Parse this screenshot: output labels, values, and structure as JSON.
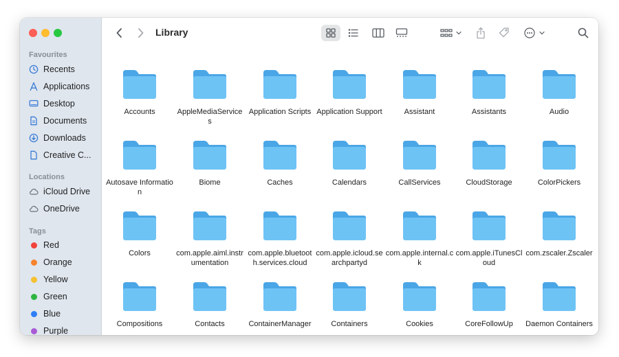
{
  "window": {
    "title": "Library"
  },
  "sidebar": {
    "favourites_heading": "Favourites",
    "favourites": [
      {
        "label": "Recents",
        "icon": "clock-icon"
      },
      {
        "label": "Applications",
        "icon": "applications-icon"
      },
      {
        "label": "Desktop",
        "icon": "desktop-icon"
      },
      {
        "label": "Documents",
        "icon": "document-icon"
      },
      {
        "label": "Downloads",
        "icon": "download-icon"
      },
      {
        "label": "Creative C...",
        "icon": "file-icon"
      }
    ],
    "locations_heading": "Locations",
    "locations": [
      {
        "label": "iCloud Drive",
        "icon": "cloud-icon"
      },
      {
        "label": "OneDrive",
        "icon": "cloud-icon"
      }
    ],
    "tags_heading": "Tags",
    "tags": [
      {
        "label": "Red",
        "color": "#f0443a"
      },
      {
        "label": "Orange",
        "color": "#f7842d"
      },
      {
        "label": "Yellow",
        "color": "#f5c132"
      },
      {
        "label": "Green",
        "color": "#2eb640"
      },
      {
        "label": "Blue",
        "color": "#2f7ef5"
      },
      {
        "label": "Purple",
        "color": "#a95bd6"
      }
    ]
  },
  "toolbar": {
    "back_icon": "chevron-left-icon",
    "forward_icon": "chevron-right-icon",
    "views": [
      "icon-view-icon",
      "list-view-icon",
      "column-view-icon",
      "gallery-view-icon"
    ],
    "group_icon": "group-icon",
    "share_icon": "share-icon",
    "tag_icon": "tag-icon",
    "more_icon": "more-icon",
    "search_icon": "search-icon"
  },
  "colors": {
    "folder_body": "#6ec3f5",
    "folder_tab": "#4aa6e6"
  },
  "folders": [
    [
      "Accounts",
      "AppleMediaServices",
      "Application Scripts",
      "Application Support",
      "Assistant",
      "Assistants",
      "Audio"
    ],
    [
      "Autosave Information",
      "Biome",
      "Caches",
      "Calendars",
      "CallServices",
      "CloudStorage",
      "ColorPickers"
    ],
    [
      "Colors",
      "com.apple.aiml.instrumentation",
      "com.apple.bluetooth.services.cloud",
      "com.apple.icloud.searchpartyd",
      "com.apple.internal.ck",
      "com.apple.iTunesCloud",
      "com.zscaler.Zscaler"
    ],
    [
      "Compositions",
      "Contacts",
      "ContainerManager",
      "Containers",
      "Cookies",
      "CoreFollowUp",
      "Daemon Containers"
    ]
  ]
}
